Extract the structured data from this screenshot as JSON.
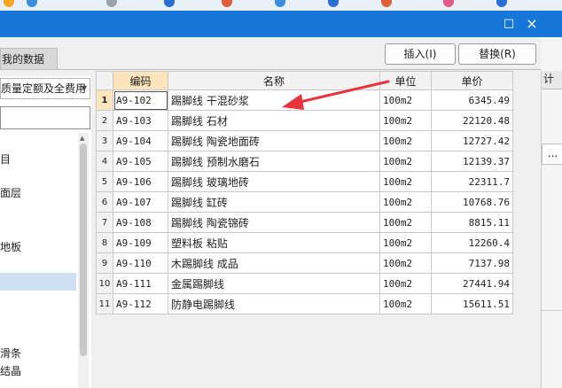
{
  "window": {
    "minimize_glyph": "□",
    "close_glyph": "×"
  },
  "tab": {
    "label": "我的数据"
  },
  "toolbar": {
    "insert_label": "插入(I)",
    "replace_label": "替换(R)"
  },
  "left": {
    "dropdown_value": "质量定额及全费用",
    "tree_items": [
      "目",
      "面层",
      "地板",
      "滑条",
      "结晶"
    ]
  },
  "table": {
    "headers": {
      "code": "编码",
      "name": "名称",
      "unit": "单位",
      "price": "单价"
    },
    "rows": [
      {
        "no": "1",
        "code": "A9-102",
        "name": "踢脚线 干混砂浆",
        "unit": "100m2",
        "price": "6345.49"
      },
      {
        "no": "2",
        "code": "A9-103",
        "name": "踢脚线 石材",
        "unit": "100m2",
        "price": "22120.48"
      },
      {
        "no": "3",
        "code": "A9-104",
        "name": "踢脚线 陶瓷地面砖",
        "unit": "100m2",
        "price": "12727.42"
      },
      {
        "no": "4",
        "code": "A9-105",
        "name": "踢脚线 预制水磨石",
        "unit": "100m2",
        "price": "12139.37"
      },
      {
        "no": "5",
        "code": "A9-106",
        "name": "踢脚线 玻璃地砖",
        "unit": "100m2",
        "price": "22311.7"
      },
      {
        "no": "6",
        "code": "A9-107",
        "name": "踢脚线 缸砖",
        "unit": "100m2",
        "price": "10768.76"
      },
      {
        "no": "7",
        "code": "A9-108",
        "name": "踢脚线 陶瓷锦砖",
        "unit": "100m2",
        "price": "8815.11"
      },
      {
        "no": "8",
        "code": "A9-109",
        "name": "塑料板 粘贴",
        "unit": "100m2",
        "price": "12260.4"
      },
      {
        "no": "9",
        "code": "A9-110",
        "name": "木踢脚线 成品",
        "unit": "100m2",
        "price": "7137.98"
      },
      {
        "no": "10",
        "code": "A9-111",
        "name": "金属踢脚线",
        "unit": "100m2",
        "price": "27441.94"
      },
      {
        "no": "11",
        "code": "A9-112",
        "name": "防静电踢脚线",
        "unit": "100m2",
        "price": "15611.51"
      }
    ]
  },
  "right": {
    "header_glyph": "计",
    "cell_glyph": "..."
  },
  "colors": {
    "titlebar": "#1677d8",
    "arrow": "#e8343c",
    "highlight": "#fce4bd"
  }
}
